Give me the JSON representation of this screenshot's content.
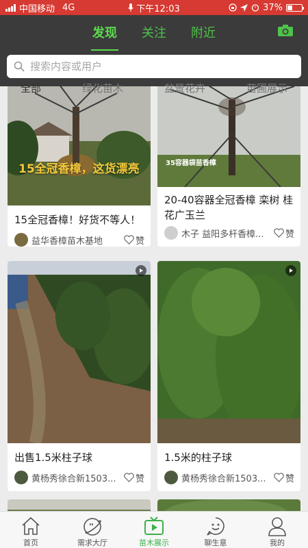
{
  "status": {
    "carrier": "中国移动",
    "network": "4G",
    "time": "下午12:03",
    "battery": "37%",
    "battery_level": 0.37
  },
  "top_tabs": [
    {
      "label": "发现",
      "active": true
    },
    {
      "label": "关注",
      "active": false
    },
    {
      "label": "附近",
      "active": false
    }
  ],
  "search": {
    "placeholder": "搜索内容或用户"
  },
  "categories": [
    "全部",
    "绿化苗木",
    "盆景花卉",
    "苗圃展示"
  ],
  "cards": [
    {
      "overlay": "15全冠香樟，这货漂亮",
      "title": "15全冠香樟！好货不等人！",
      "author": "益华香樟苗木基地",
      "like": "赞"
    },
    {
      "overlay": "35容器袋苗香樟",
      "title": "20-40容器全冠香樟 栾树 桂花广玉兰",
      "author": "木子 益阳多杆香樟...",
      "like": "赞"
    },
    {
      "title": "出售1.5米柱子球",
      "author": "黄杨秀徐合新1503...",
      "like": "赞"
    },
    {
      "title": "1.5米的柱子球",
      "author": "黄杨秀徐合新1503...",
      "like": "赞"
    }
  ],
  "bottom_nav": [
    {
      "label": "首页",
      "icon": "home-icon",
      "active": false
    },
    {
      "label": "需求大厅",
      "icon": "planet-icon",
      "active": false
    },
    {
      "label": "苗木展示",
      "icon": "tv-icon",
      "active": true
    },
    {
      "label": "聊生意",
      "icon": "chat-face-icon",
      "active": false
    },
    {
      "label": "我的",
      "icon": "person-icon",
      "active": false
    }
  ],
  "colors": {
    "status_bar": "#d63a32",
    "header": "#3b3b3b",
    "accent_green": "#5cdc4e",
    "overlay_yellow": "#f3c83b"
  }
}
